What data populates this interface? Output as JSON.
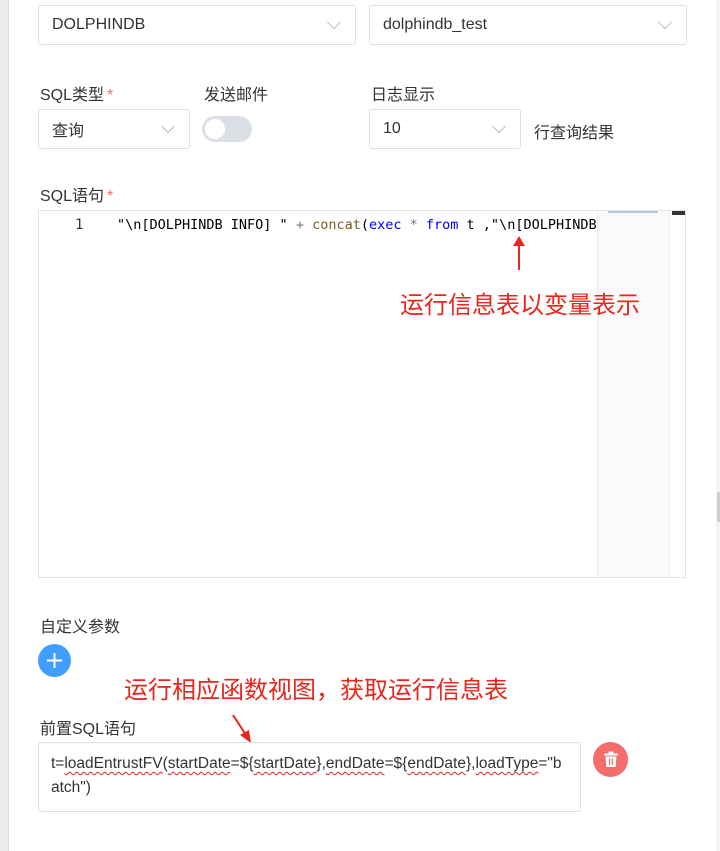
{
  "datasource": {
    "type_value": "DOLPHINDB",
    "db_value": "dolphindb_test"
  },
  "sql_type": {
    "label": "SQL类型",
    "required_mark": "*",
    "value": "查询"
  },
  "email": {
    "label": "发送邮件",
    "enabled": false
  },
  "log": {
    "label": "日志显示",
    "value": "10",
    "suffix": "行查询结果"
  },
  "sql": {
    "label": "SQL语句",
    "required_mark": "*",
    "line_number": "1",
    "tokens": [
      {
        "t": "\"\\n[DOLPHINDB INFO] \" ",
        "c": "str"
      },
      {
        "t": "+ ",
        "c": "op"
      },
      {
        "t": "concat",
        "c": "fn"
      },
      {
        "t": "(",
        "c": "str"
      },
      {
        "t": "exec",
        "c": "kw"
      },
      {
        "t": " * ",
        "c": "op"
      },
      {
        "t": "from",
        "c": "kw"
      },
      {
        "t": " t ,\"\\n[DOLPHINDB INFO] \")",
        "c": "str"
      }
    ]
  },
  "annotations": {
    "variable_note": "运行信息表以变量表示",
    "function_note": "运行相应函数视图，获取运行信息表"
  },
  "custom_params": {
    "label": "自定义参数"
  },
  "pre_sql": {
    "label": "前置SQL语句",
    "parts": [
      {
        "t": "t=",
        "err": false
      },
      {
        "t": "loadEntrustFV",
        "err": true
      },
      {
        "t": "(",
        "err": false
      },
      {
        "t": "startDate",
        "err": true
      },
      {
        "t": "=${",
        "err": false
      },
      {
        "t": "startDate",
        "err": true
      },
      {
        "t": "},",
        "err": false
      },
      {
        "t": "endDate",
        "err": true
      },
      {
        "t": "=${",
        "err": false
      },
      {
        "t": "endDate",
        "err": true
      },
      {
        "t": "},",
        "err": false
      },
      {
        "t": "loadType",
        "err": true
      },
      {
        "t": "=\"batch\")",
        "err": false
      }
    ]
  },
  "colors": {
    "accent": "#409eff",
    "danger": "#f56c6c",
    "annotation": "#e8261c",
    "required": "#f56c6c"
  },
  "icons": {
    "add": "plus-icon",
    "delete": "trash-icon",
    "dropdown": "chevron-down-icon"
  }
}
